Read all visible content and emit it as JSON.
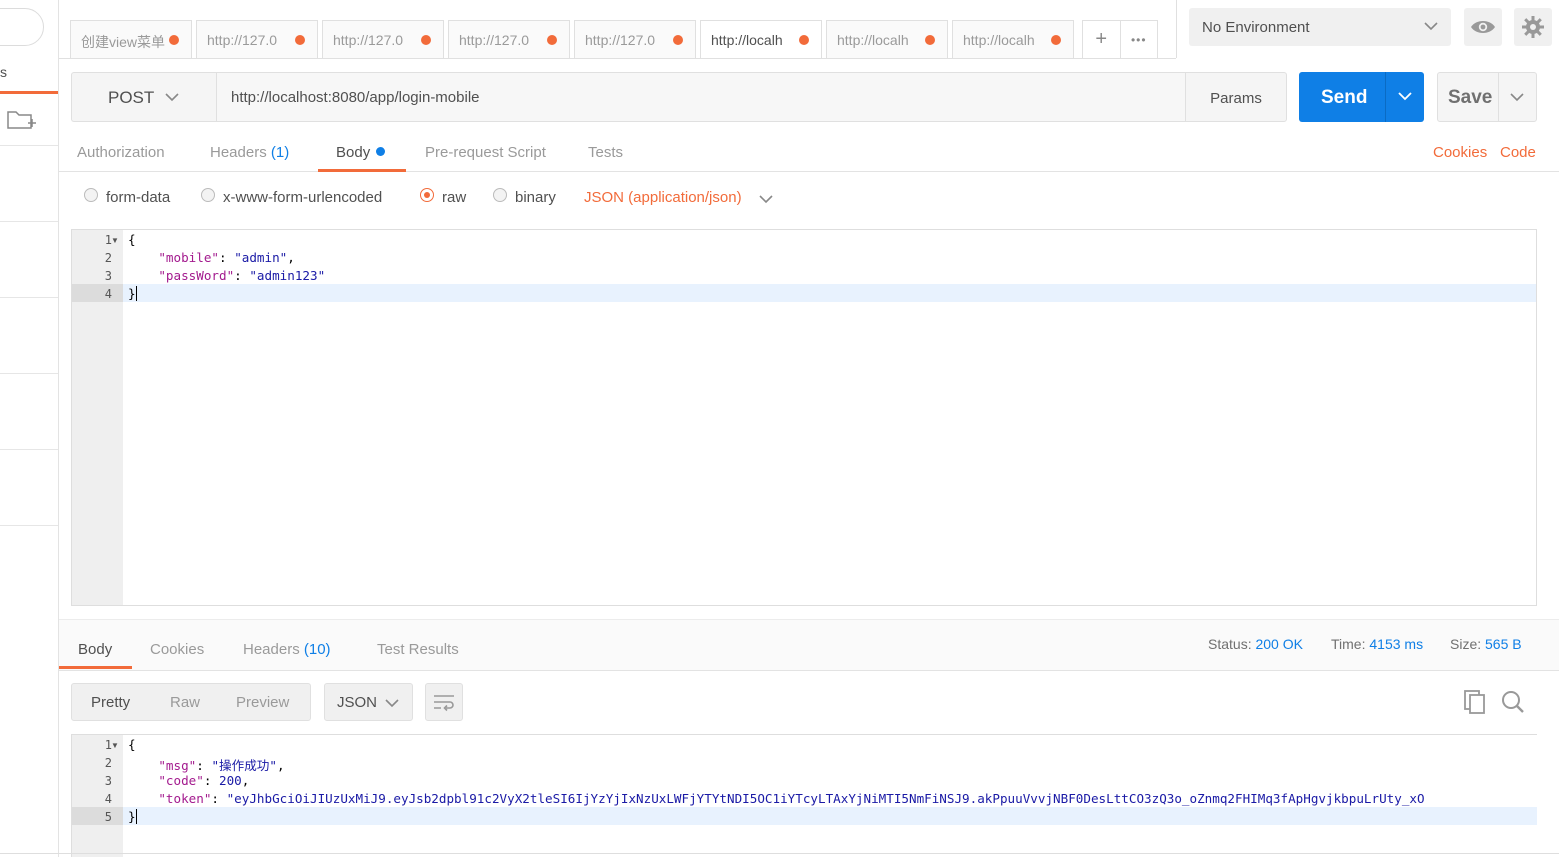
{
  "sidebar": {
    "tab_label": "s"
  },
  "tabs": [
    {
      "label": "创建view菜单"
    },
    {
      "label": "http://127.0"
    },
    {
      "label": "http://127.0"
    },
    {
      "label": "http://127.0"
    },
    {
      "label": "http://127.0"
    },
    {
      "label": "http://localh"
    },
    {
      "label": "http://localh"
    },
    {
      "label": "http://localh"
    }
  ],
  "tab_actions": {
    "add": "+",
    "more": "•••"
  },
  "environment": {
    "selected": "No Environment"
  },
  "request": {
    "method": "POST",
    "url": "http://localhost:8080/app/login-mobile",
    "params_label": "Params",
    "send_label": "Send",
    "save_label": "Save"
  },
  "request_tabs": {
    "authorization": "Authorization",
    "headers": "Headers",
    "headers_count": "(1)",
    "body": "Body",
    "prerequest": "Pre-request Script",
    "tests": "Tests",
    "cookies": "Cookies",
    "code": "Code"
  },
  "body_types": {
    "form_data": "form-data",
    "urlencoded": "x-www-form-urlencoded",
    "raw": "raw",
    "binary": "binary",
    "content_type": "JSON (application/json)"
  },
  "request_body": {
    "line_numbers": [
      "1",
      "2",
      "3",
      "4"
    ],
    "open_brace": "{",
    "mobile_key": "\"mobile\"",
    "mobile_value": "\"admin\"",
    "password_key": "\"passWord\"",
    "password_value": "\"admin123\"",
    "close_brace": "}"
  },
  "response_tabs": {
    "body": "Body",
    "cookies": "Cookies",
    "headers": "Headers",
    "headers_count": "(10)",
    "test_results": "Test Results"
  },
  "response_status": {
    "status_label": "Status:",
    "status_value": "200 OK",
    "time_label": "Time:",
    "time_value": "4153 ms",
    "size_label": "Size:",
    "size_value": "565 B"
  },
  "response_view": {
    "pretty": "Pretty",
    "raw": "Raw",
    "preview": "Preview",
    "format": "JSON"
  },
  "response_body": {
    "line_numbers": [
      "1",
      "2",
      "3",
      "4",
      "5"
    ],
    "open_brace": "{",
    "msg_key": "\"msg\"",
    "msg_value": "\"操作成功\"",
    "code_key": "\"code\"",
    "code_value": "200",
    "token_key": "\"token\"",
    "token_value": "\"eyJhbGciOiJIUzUxMiJ9.eyJsb2dpbl91c2VyX2tleSI6IjYzYjIxNzUxLWFjYTYtNDI5OC1iYTcyLTAxYjNiMTI5NmFiNSJ9.akPpuuVvvjNBF0DesLttCO3zQ3o_oZnmq2FHIMq3fApHgvjkbpuLrUty_xO",
    "close_brace": "}"
  },
  "colors": {
    "accent": "#f26b3a",
    "primary": "#0f7fe6"
  }
}
